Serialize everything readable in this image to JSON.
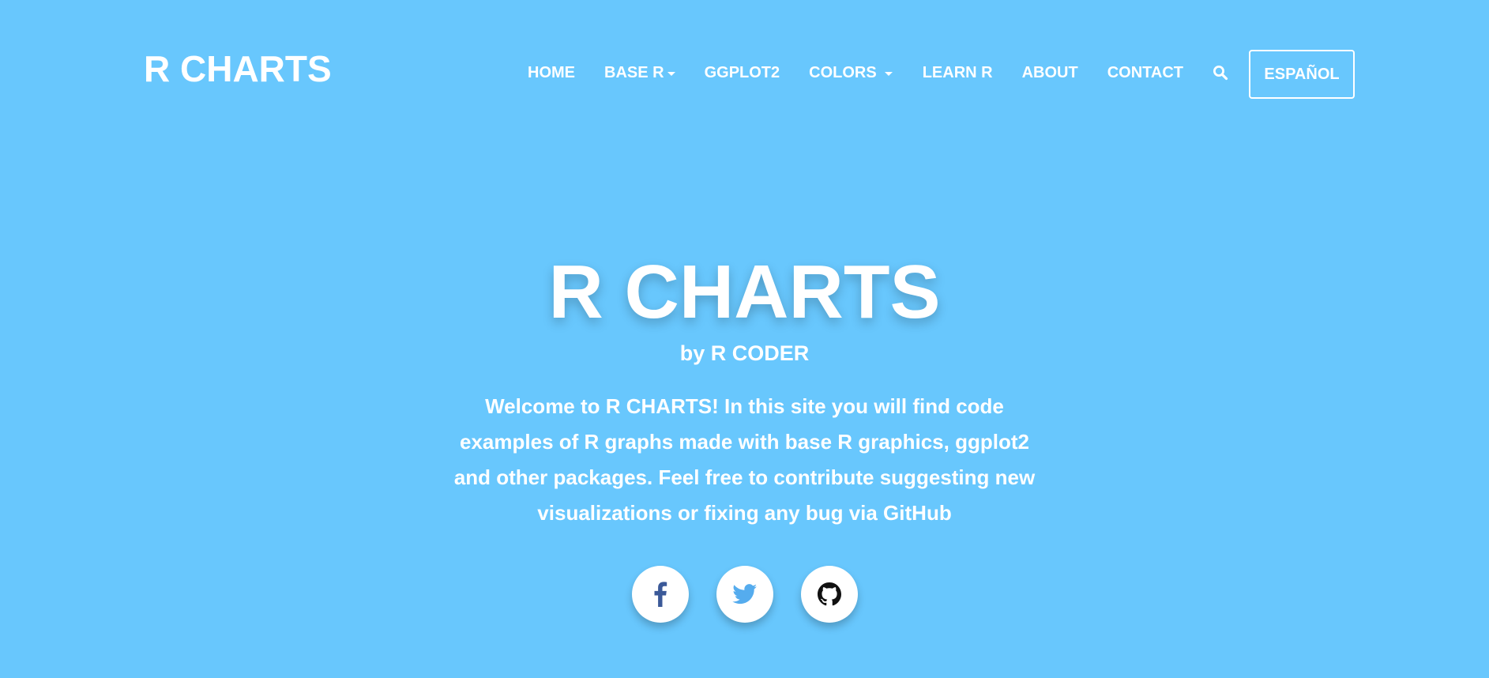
{
  "brand": {
    "name": "R CHARTS"
  },
  "nav": {
    "items": [
      {
        "label": "HOME",
        "dropdown": false
      },
      {
        "label": "BASE R",
        "dropdown": true
      },
      {
        "label": "GGPLOT2",
        "dropdown": false
      },
      {
        "label": "COLORS",
        "dropdown": true
      },
      {
        "label": "LEARN R",
        "dropdown": false
      },
      {
        "label": "ABOUT",
        "dropdown": false
      },
      {
        "label": "CONTACT",
        "dropdown": false
      }
    ],
    "search_icon": "search-icon",
    "language_button": "ESPAÑOL"
  },
  "hero": {
    "title": "R CHARTS",
    "byline": "by R CODER",
    "welcome": "Welcome to R CHARTS! In this site you will find code examples of R graphs made with base R graphics, ggplot2 and other packages. Feel free to contribute suggesting new visualizations or fixing any bug via GitHub"
  },
  "social": {
    "icons": [
      "facebook-icon",
      "twitter-icon",
      "github-icon"
    ]
  },
  "colors": {
    "background": "#68c7fd",
    "text": "#ffffff",
    "facebook": "#3b5998",
    "twitter": "#55acee",
    "github": "#111111"
  }
}
